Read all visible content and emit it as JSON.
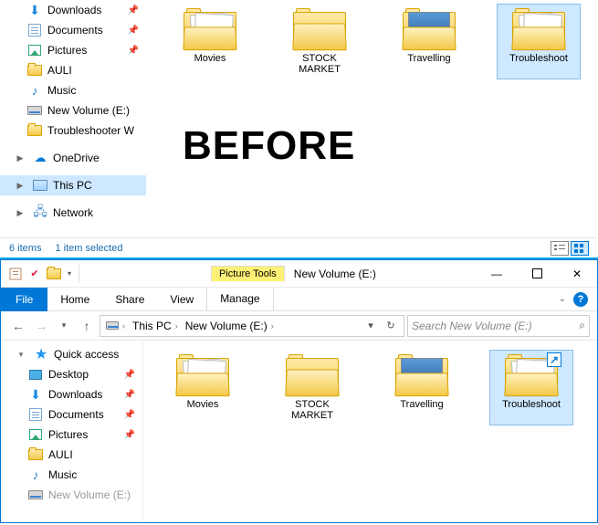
{
  "before_label": "BEFORE",
  "top": {
    "tree": [
      {
        "icon": "dl",
        "label": "Downloads",
        "pin": true
      },
      {
        "icon": "docs",
        "label": "Documents",
        "pin": true
      },
      {
        "icon": "pics",
        "label": "Pictures",
        "pin": true
      },
      {
        "icon": "folder",
        "label": "AULI",
        "pin": false
      },
      {
        "icon": "music",
        "label": "Music",
        "pin": false
      },
      {
        "icon": "drive",
        "label": "New Volume (E:)",
        "pin": false
      },
      {
        "icon": "folder",
        "label": "Troubleshooter W",
        "pin": false
      }
    ],
    "onedrive": "OneDrive",
    "thispc": "This PC",
    "network": "Network",
    "folders": [
      {
        "name": "Movies",
        "kind": "docs"
      },
      {
        "name": "STOCK MARKET",
        "kind": "empty"
      },
      {
        "name": "Travelling",
        "kind": "pic"
      },
      {
        "name": "Troubleshoot",
        "kind": "docs",
        "selected": true
      }
    ],
    "status": {
      "count": "6 items",
      "sel": "1 item selected"
    }
  },
  "bottom": {
    "title": "New Volume (E:)",
    "pic_tools": "Picture Tools",
    "ribbon": {
      "file": "File",
      "home": "Home",
      "share": "Share",
      "view": "View",
      "manage": "Manage"
    },
    "addr": {
      "pc": "This PC",
      "vol": "New Volume (E:)"
    },
    "search_ph": "Search New Volume (E:)",
    "tree": {
      "qa": "Quick access",
      "items": [
        {
          "icon": "desktop",
          "label": "Desktop",
          "pin": true
        },
        {
          "icon": "dl",
          "label": "Downloads",
          "pin": true
        },
        {
          "icon": "docs",
          "label": "Documents",
          "pin": true
        },
        {
          "icon": "pics",
          "label": "Pictures",
          "pin": true
        },
        {
          "icon": "folder",
          "label": "AULI",
          "pin": false
        },
        {
          "icon": "music",
          "label": "Music",
          "pin": false
        },
        {
          "icon": "drive",
          "label": "New Volume (E:)",
          "pin": false
        }
      ]
    },
    "folders": [
      {
        "name": "Movies",
        "kind": "docs"
      },
      {
        "name": "STOCK MARKET",
        "kind": "empty"
      },
      {
        "name": "Travelling",
        "kind": "pic"
      },
      {
        "name": "Troubleshoot",
        "kind": "docs",
        "selected": true,
        "share": true
      }
    ]
  }
}
